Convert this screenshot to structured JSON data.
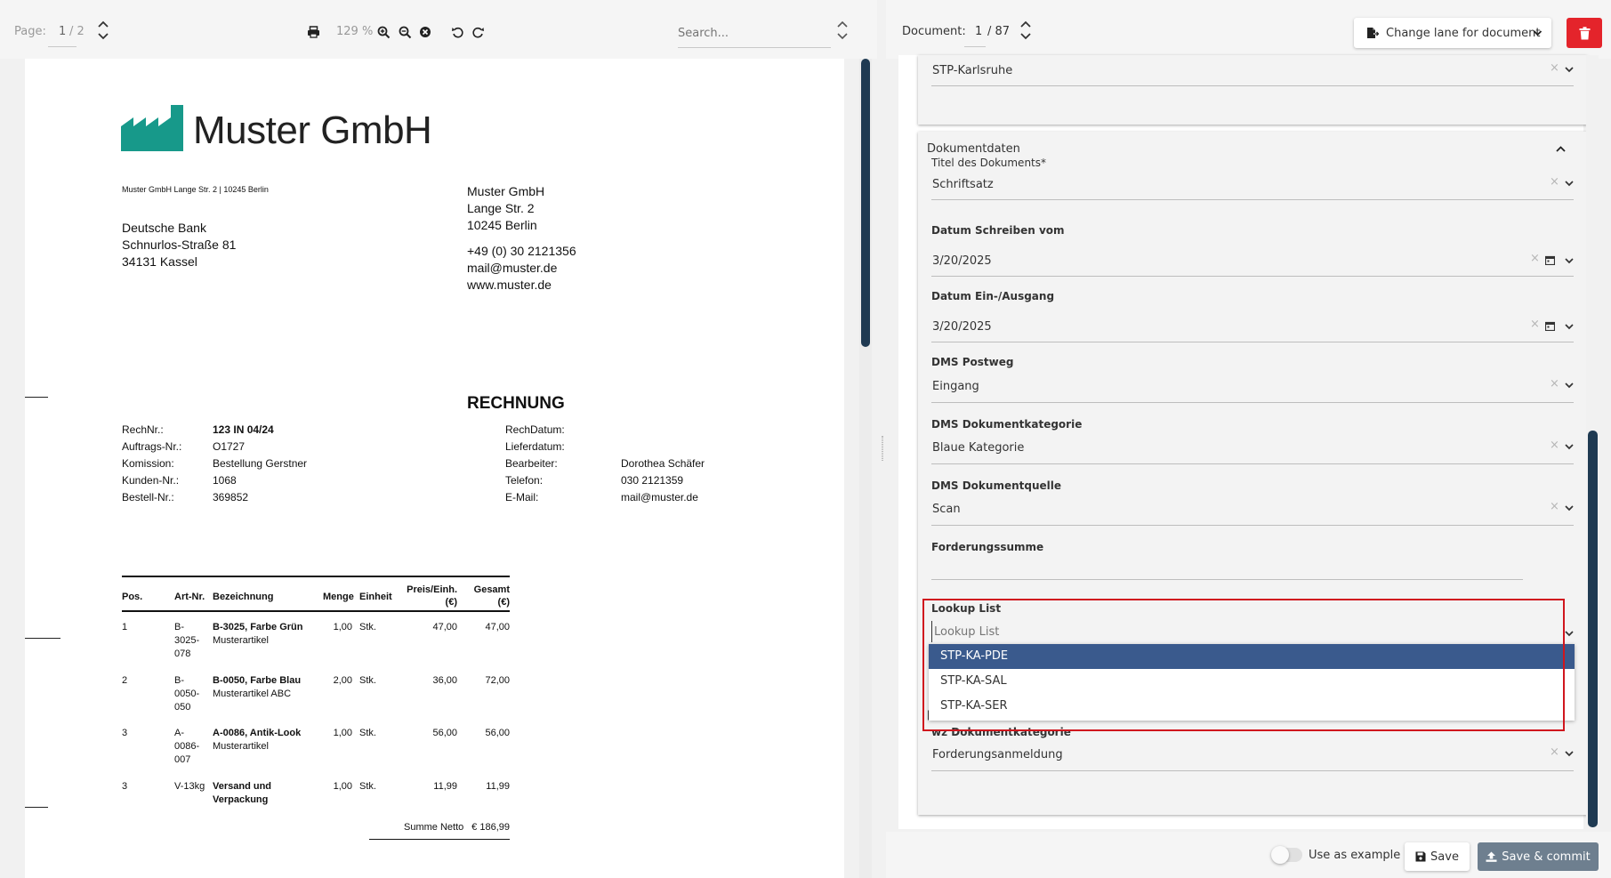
{
  "viewer": {
    "page_label": "Page:",
    "page_current": "1",
    "page_total": "/ 2",
    "zoom": "129 %",
    "search_placeholder": "Search..."
  },
  "doc": {
    "logo_text": "Muster GmbH",
    "brand_color": "#17998a",
    "sender_line": "Muster GmbH Lange Str. 2 | 10245 Berlin",
    "recipient": [
      "Deutsche Bank",
      "Schnurlos-Straße 81",
      "34131 Kassel"
    ],
    "company_address": [
      "Muster GmbH",
      "Lange Str. 2",
      "10245 Berlin"
    ],
    "company_contact": [
      "+49 (0) 30 2121356",
      "mail@muster.de",
      "www.muster.de"
    ],
    "title": "RECHNUNG",
    "left_meta": [
      {
        "label": "RechNr.:",
        "value": "123 IN 04/24"
      },
      {
        "label": "Auftrags-Nr.:",
        "value": "O1727"
      },
      {
        "label": "Komission:",
        "value": "Bestellung Gerstner"
      },
      {
        "label": "Kunden-Nr.:",
        "value": "1068"
      },
      {
        "label": "Bestell-Nr.:",
        "value": "369852"
      }
    ],
    "right_meta": [
      {
        "label": "RechDatum:",
        "value": ""
      },
      {
        "label": "Lieferdatum:",
        "value": ""
      },
      {
        "label": "Bearbeiter:",
        "value": "Dorothea Schäfer"
      },
      {
        "label": "Telefon:",
        "value": "030 2121359"
      },
      {
        "label": "E-Mail:",
        "value": "mail@muster.de"
      }
    ],
    "table_headers": {
      "pos": "Pos.",
      "art": "Art-Nr.",
      "bez": "Bezeichnung",
      "menge": "Menge",
      "einheit": "Einheit",
      "preis_1": "Preis/Einh.",
      "preis_2": "(€)",
      "gesamt_1": "Gesamt",
      "gesamt_2": "(€)"
    },
    "rows": [
      {
        "pos": "1",
        "art": [
          "B-",
          "3025-",
          "078"
        ],
        "name": "B-3025, Farbe Grün",
        "sub": "Musterartikel",
        "menge": "1,00",
        "einheit": "Stk.",
        "preis": "47,00",
        "gesamt": "47,00"
      },
      {
        "pos": "2",
        "art": [
          "B-",
          "0050-",
          "050"
        ],
        "name": "B-0050, Farbe Blau",
        "sub": "Musterartikel ABC",
        "menge": "2,00",
        "einheit": "Stk.",
        "preis": "36,00",
        "gesamt": "72,00"
      },
      {
        "pos": "3",
        "art": [
          "A-",
          "0086-",
          "007"
        ],
        "name": "A-0086, Antik-Look",
        "sub": "Musterartikel",
        "menge": "1,00",
        "einheit": "Stk.",
        "preis": "56,00",
        "gesamt": "56,00"
      },
      {
        "pos": "3",
        "art": [
          "V-13kg",
          "",
          ""
        ],
        "name": "Versand und",
        "sub": "Verpackung",
        "menge": "1,00",
        "einheit": "Stk.",
        "preis": "11,99",
        "gesamt": "11,99"
      }
    ],
    "summe_label": "Summe Netto",
    "summe_value": "€ 186,99"
  },
  "panel": {
    "document_label": "Document:",
    "document_current": "1",
    "document_total": "/ 87",
    "change_lane_label": "Change lane for document",
    "top_field_value": "STP-Karlsruhe",
    "section_title": "Dokumentdaten",
    "fields": {
      "titel": {
        "label": "Titel des Dokuments*",
        "value": "Schriftsatz"
      },
      "datum_schreiben": {
        "label": "Datum Schreiben vom",
        "value": "3/20/2025"
      },
      "datum_ein": {
        "label": "Datum Ein-/Ausgang",
        "value": "3/20/2025"
      },
      "postweg": {
        "label": "DMS Postweg",
        "value": "Eingang"
      },
      "kategorie": {
        "label": "DMS Dokumentkategorie",
        "value": "Blaue Kategorie"
      },
      "quelle": {
        "label": "DMS Dokumentquelle",
        "value": "Scan"
      },
      "forderung": {
        "label": "Forderungssumme",
        "value": ""
      },
      "lookup": {
        "label": "Lookup List",
        "placeholder": "Lookup List"
      },
      "wz": {
        "label": "wz Dokumentkategorie",
        "value": "Forderungsanmeldung"
      }
    },
    "lookup_options": [
      "STP-KA-PDE",
      "STP-KA-SAL",
      "STP-KA-SER"
    ],
    "lookup_selected_index": 0,
    "highlight_color": "#d0161e",
    "footer": {
      "use_example_label": "Use as example",
      "save_label": "Save",
      "commit_label": "Save & commit"
    }
  }
}
